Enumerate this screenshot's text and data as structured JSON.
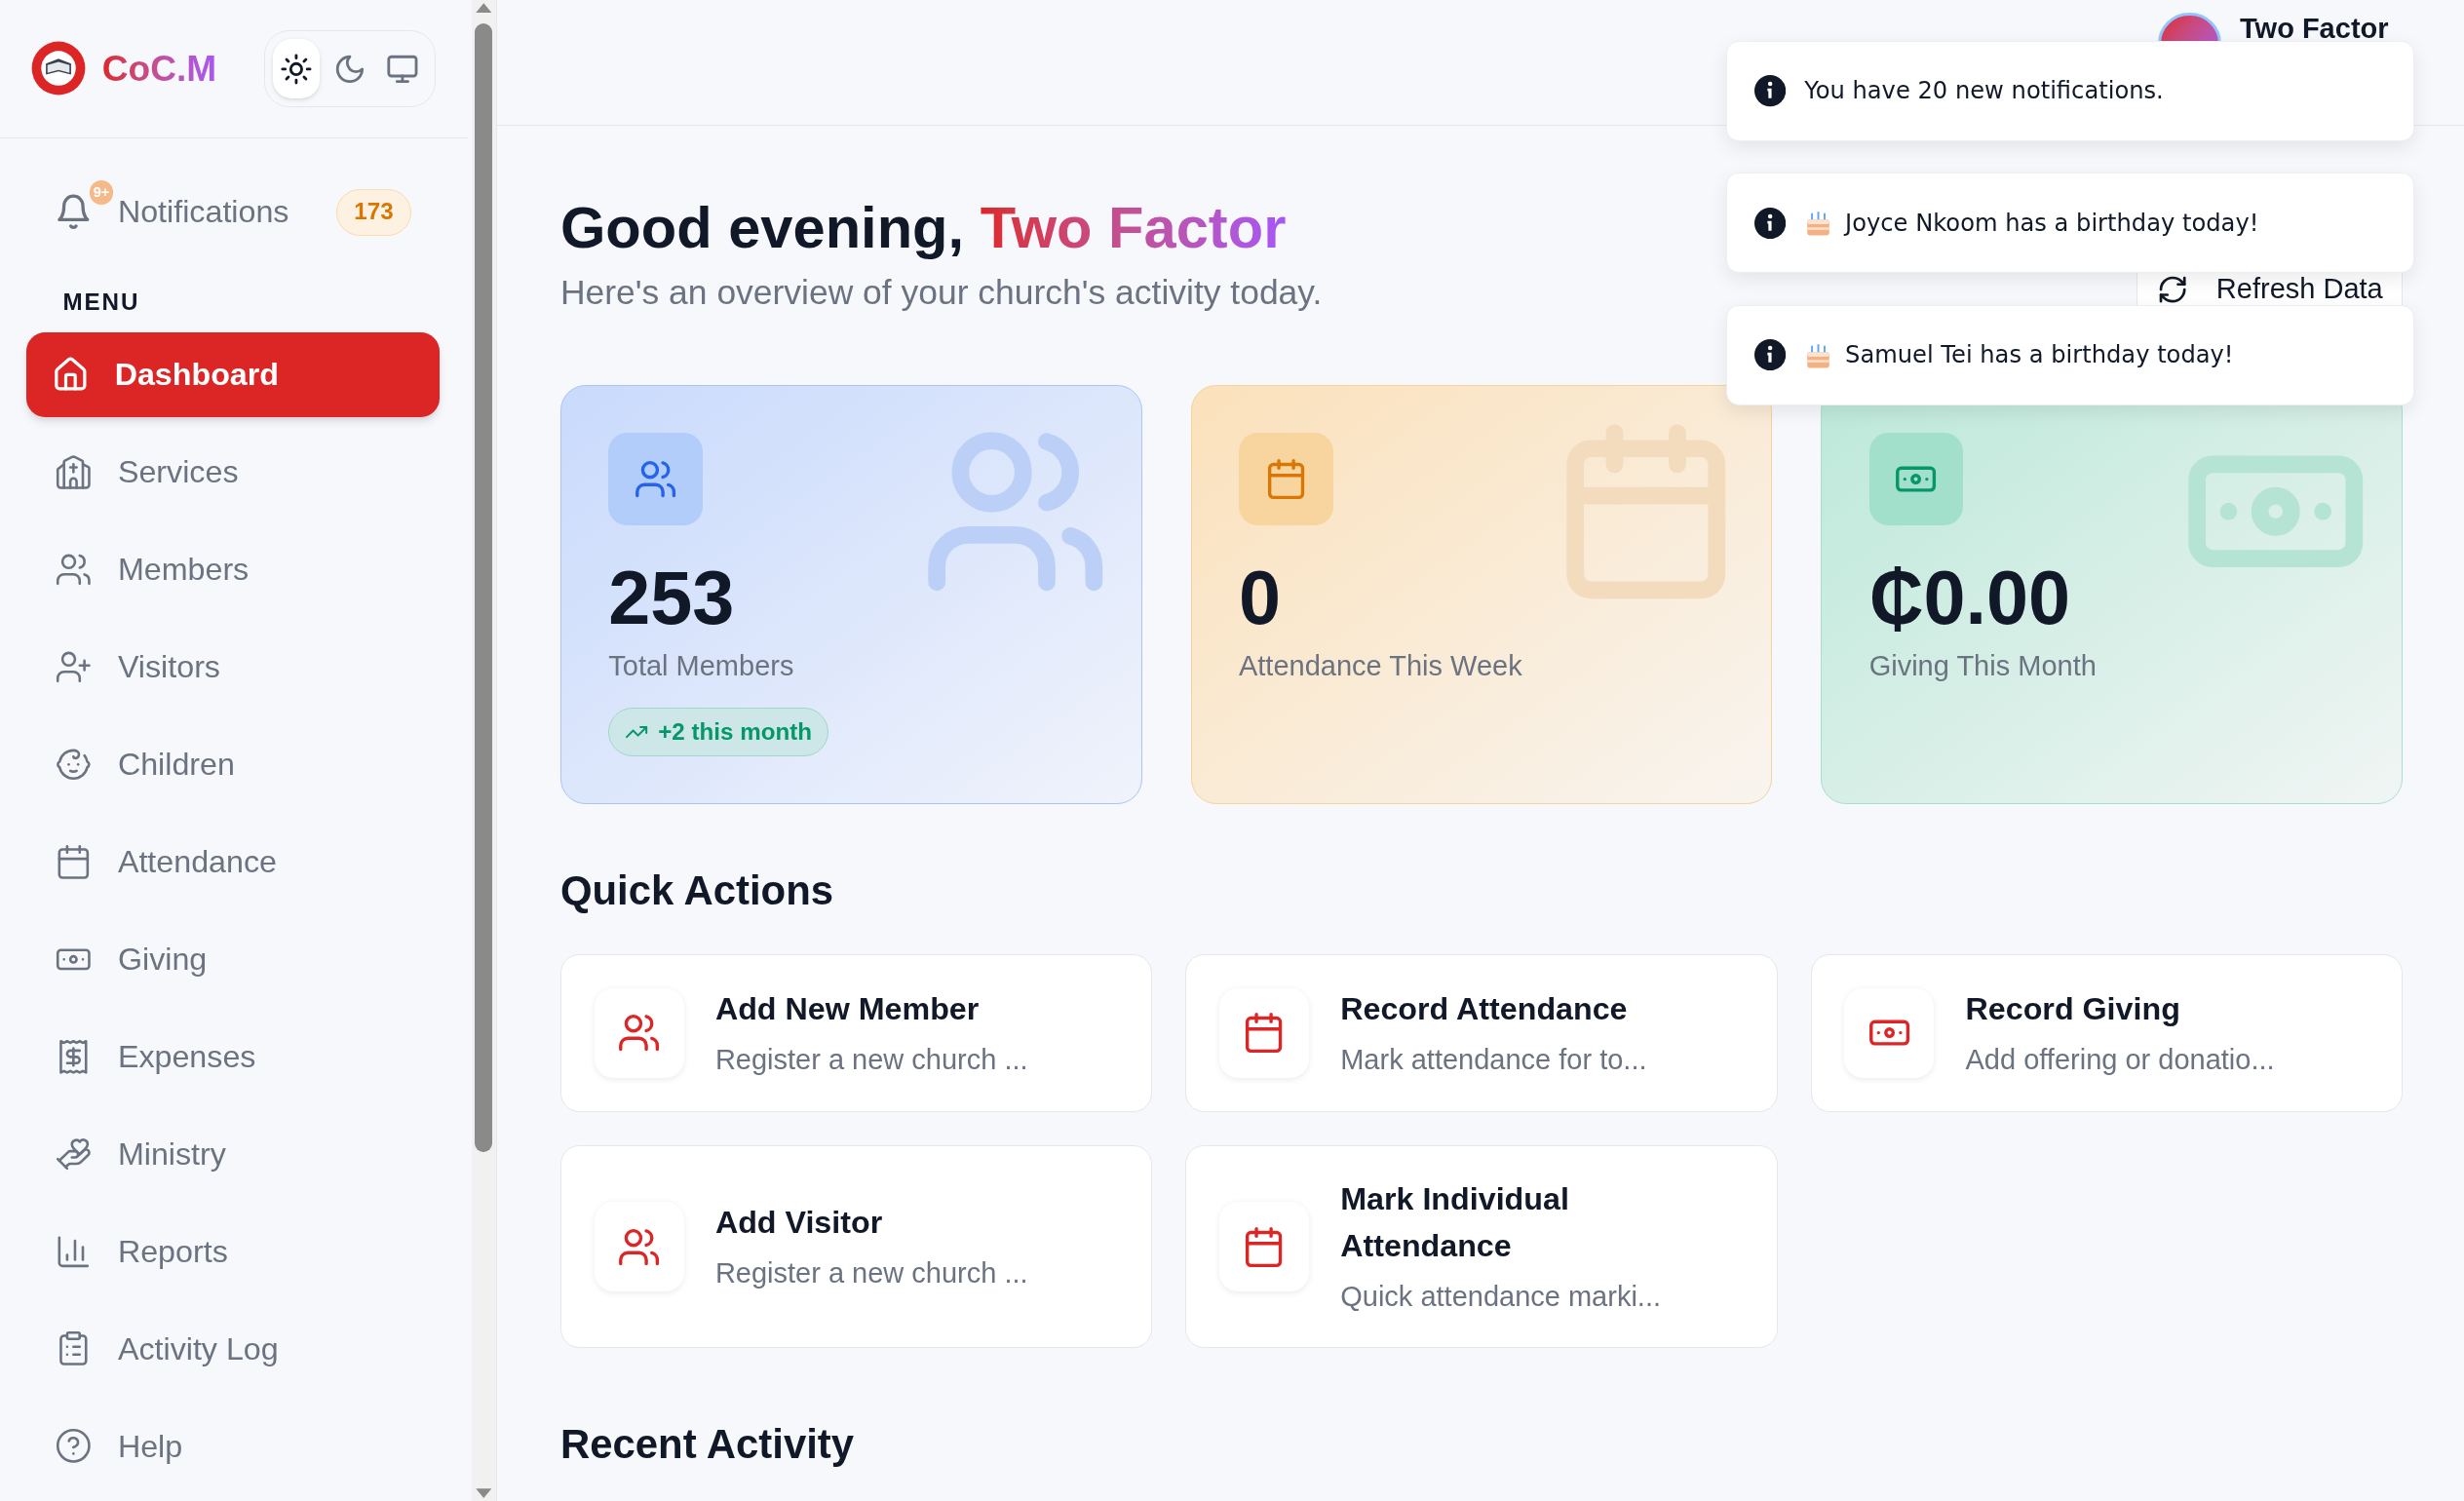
{
  "sidebar": {
    "brand": "CoC.M",
    "theme_modes": [
      {
        "selected": true
      },
      {
        "selected": false
      },
      {
        "selected": false
      }
    ],
    "notifications": {
      "label": "Notifications",
      "dot": "9+",
      "count": "173"
    },
    "section_label": "MENU",
    "items": [
      {
        "label": "Dashboard",
        "selected": true
      },
      {
        "label": "Services",
        "selected": false
      },
      {
        "label": "Members",
        "selected": false
      },
      {
        "label": "Visitors",
        "selected": false
      },
      {
        "label": "Children",
        "selected": false
      },
      {
        "label": "Attendance",
        "selected": false
      },
      {
        "label": "Giving",
        "selected": false
      },
      {
        "label": "Expenses",
        "selected": false
      },
      {
        "label": "Ministry",
        "selected": false
      },
      {
        "label": "Reports",
        "selected": false
      },
      {
        "label": "Activity Log",
        "selected": false
      },
      {
        "label": "Help",
        "selected": false
      }
    ]
  },
  "header": {
    "user_name": "Two Factor"
  },
  "greeting": {
    "prefix": "Good evening,",
    "name": "Two Factor",
    "subtitle": "Here's an overview of your church's activity today.",
    "refresh_button": "Refresh Data"
  },
  "stats": [
    {
      "kind": "members",
      "value": "253",
      "label": "Total Members",
      "trend": "+2 this month"
    },
    {
      "kind": "attendance",
      "value": "0",
      "label": "Attendance This Week"
    },
    {
      "kind": "giving",
      "value": "₵0.00",
      "label": "Giving This Month"
    }
  ],
  "quick_actions": {
    "title": "Quick Actions",
    "items": [
      {
        "kind": "people",
        "title": "Add New Member",
        "description": "Register a new church ..."
      },
      {
        "kind": "calendar",
        "title": "Record Attendance",
        "description": "Mark attendance for to..."
      },
      {
        "kind": "money",
        "title": "Record Giving",
        "description": "Add offering or donatio..."
      },
      {
        "kind": "people",
        "title": "Add Visitor",
        "description": "Register a new church ..."
      },
      {
        "kind": "calendar",
        "title": "Mark Individual Attendance",
        "description": "Quick attendance marki..."
      }
    ]
  },
  "recent_activity": {
    "title": "Recent Activity"
  },
  "toasts": [
    {
      "kind": "info",
      "text": "You have 20 new notifications."
    },
    {
      "kind": "birthday",
      "text": "Joyce Nkoom has a birthday today!"
    },
    {
      "kind": "birthday",
      "text": "Samuel Tei has a birthday today!"
    }
  ]
}
